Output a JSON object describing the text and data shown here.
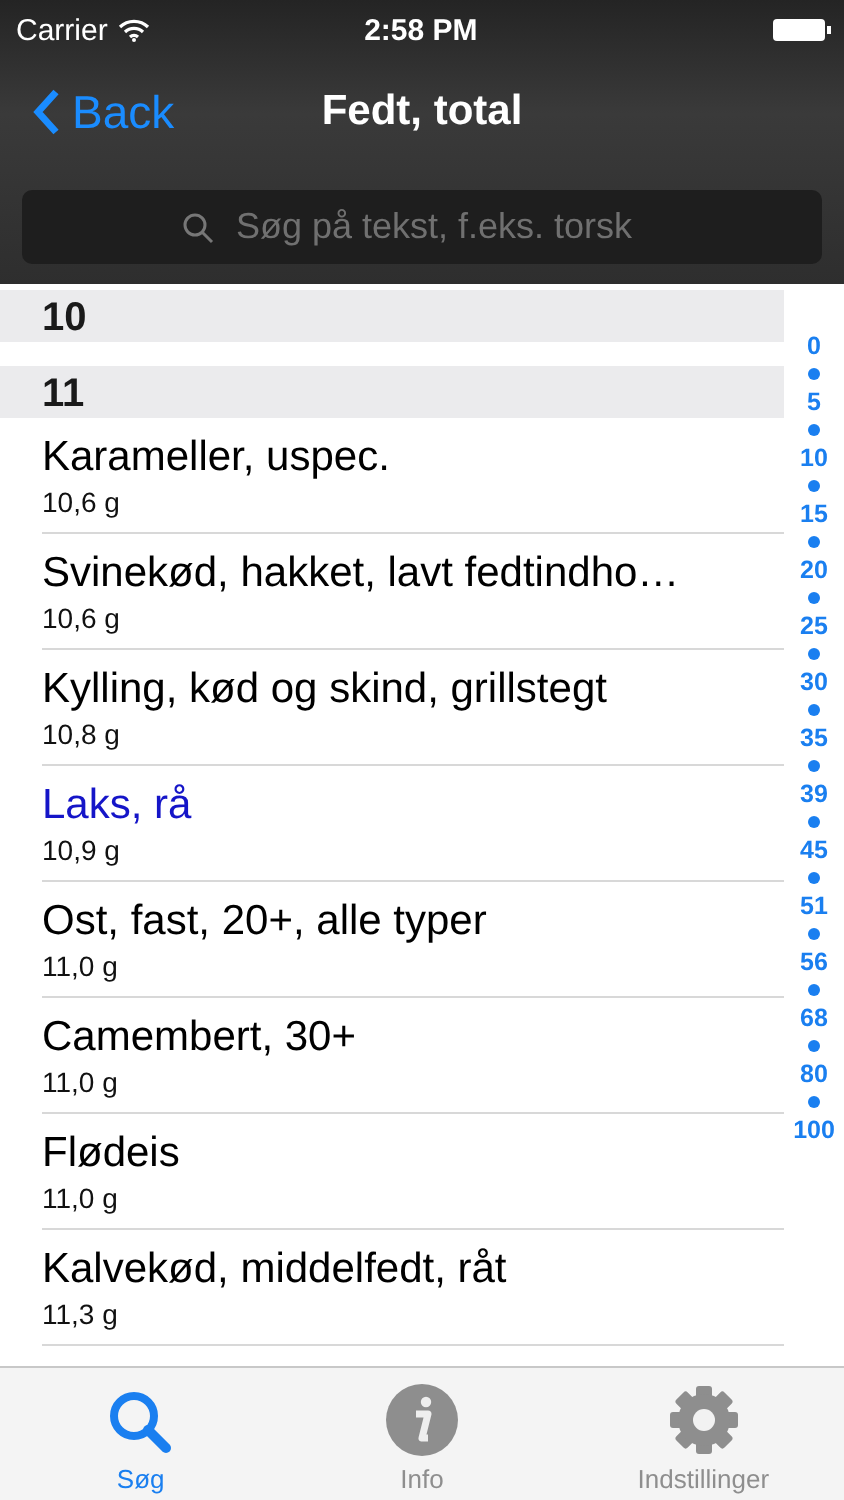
{
  "status_bar": {
    "carrier": "Carrier",
    "time": "2:58 PM"
  },
  "nav": {
    "back": "Back",
    "title": "Fedt, total"
  },
  "search": {
    "placeholder": "Søg på tekst, f.eks. torsk"
  },
  "sections": [
    {
      "header": "10"
    },
    {
      "header": "11",
      "items": [
        {
          "name": "Karameller, uspec.",
          "amount": "10,6 g",
          "selected": false
        },
        {
          "name": "Svinekød, hakket, lavt fedtindho…",
          "amount": "10,6 g",
          "selected": false
        },
        {
          "name": "Kylling, kød og skind, grillstegt",
          "amount": "10,8 g",
          "selected": false
        },
        {
          "name": "Laks, rå",
          "amount": "10,9 g",
          "selected": true
        },
        {
          "name": "Ost, fast, 20+, alle typer",
          "amount": "11,0 g",
          "selected": false
        },
        {
          "name": "Camembert, 30+",
          "amount": "11,0 g",
          "selected": false
        },
        {
          "name": "Flødeis",
          "amount": "11,0 g",
          "selected": false
        },
        {
          "name": "Kalvekød, middelfedt, råt",
          "amount": "11,3 g",
          "selected": false
        }
      ]
    }
  ],
  "index": [
    "0",
    "5",
    "10",
    "15",
    "20",
    "25",
    "30",
    "35",
    "39",
    "45",
    "51",
    "56",
    "68",
    "80",
    "100"
  ],
  "tabs": [
    {
      "label": "Søg",
      "kind": "search",
      "selected": true
    },
    {
      "label": "Info",
      "kind": "info",
      "selected": false
    },
    {
      "label": "Indstillinger",
      "kind": "settings",
      "selected": false
    }
  ]
}
